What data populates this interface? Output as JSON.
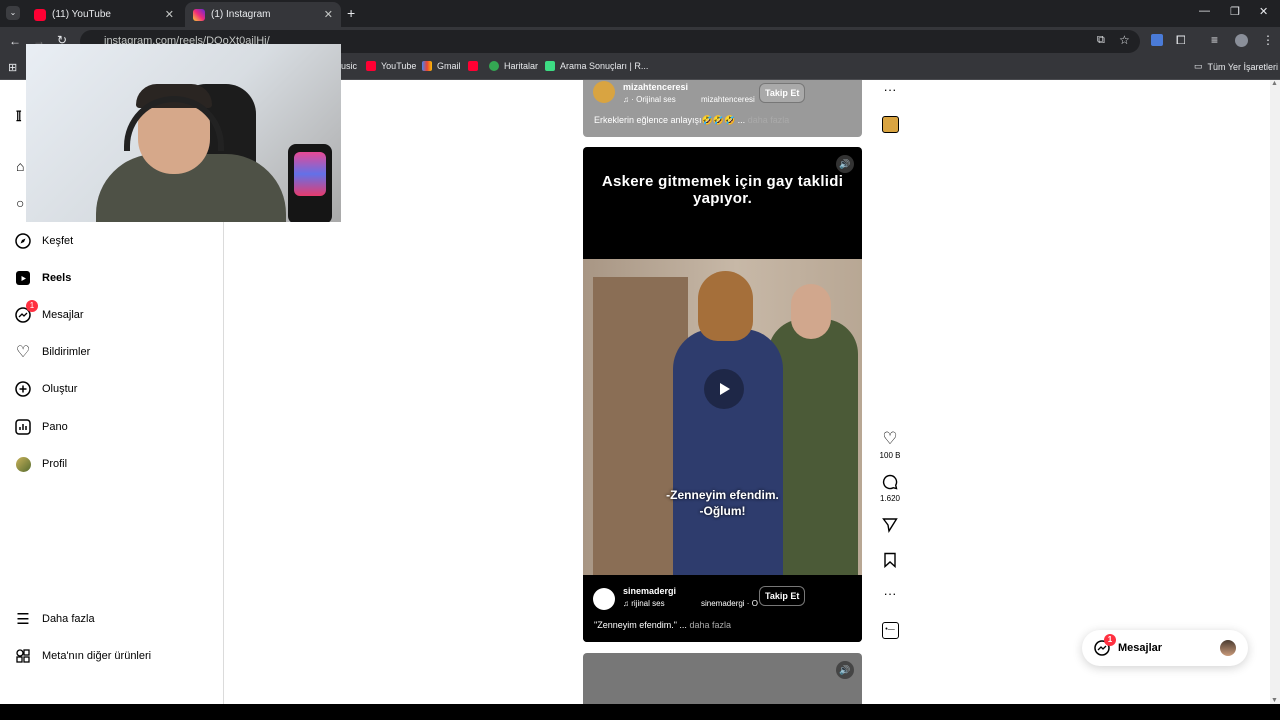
{
  "browser": {
    "tabs": [
      {
        "label": "(11) YouTube",
        "color": "#ff0033"
      },
      {
        "label": "(1) Instagram",
        "color": "#e1306c"
      }
    ],
    "url": "instagram.com/reels/DQoXt0ailHi/",
    "bookmarks": [
      {
        "label": "usic"
      },
      {
        "label": "YouTube"
      },
      {
        "label": "Gmail"
      },
      {
        "label": ""
      },
      {
        "label": "Haritalar"
      },
      {
        "label": "Arama Sonuçları | R..."
      }
    ],
    "all_bookmarks": "Tüm Yer İşaretleri"
  },
  "sidebar": {
    "items": [
      {
        "label": "Keşfet",
        "icon": "compass-icon"
      },
      {
        "label": "Reels",
        "icon": "reels-icon"
      },
      {
        "label": "Mesajlar",
        "icon": "messenger-icon",
        "badge": "1"
      },
      {
        "label": "Bildirimler",
        "icon": "heart-icon"
      },
      {
        "label": "Oluştur",
        "icon": "plus-square-icon"
      },
      {
        "label": "Pano",
        "icon": "dashboard-icon"
      },
      {
        "label": "Profil",
        "icon": "avatar-icon"
      }
    ],
    "bottom": [
      {
        "label": "Daha fazla",
        "icon": "menu-icon"
      },
      {
        "label": "Meta'nın diğer ürünleri",
        "icon": "meta-products-icon"
      }
    ]
  },
  "reel_prev": {
    "username": "mizahtenceresi",
    "audio": "· Orijinal ses",
    "audio_credit": "mizahtenceresi",
    "follow": "Takip Et",
    "caption": "Erkeklerin eğlence anlayışı🤣🤣🤣 ...",
    "more": "daha fazla"
  },
  "reel_main": {
    "headline": "Askere gitmemek için gay taklidi yapıyor.",
    "subtitle_1": "-Zenneyim efendim.",
    "subtitle_2": "-Oğlum!",
    "username": "sinemadergi",
    "audio": "rijinal ses",
    "audio_credit": "sinemadergi · O",
    "follow": "Takip Et",
    "caption": "\"Zenneyim efendim.\" ...",
    "more": "daha fazla",
    "likes": "100 B",
    "comments": "1.620"
  },
  "messages_pill": {
    "label": "Mesajlar",
    "badge": "1"
  }
}
